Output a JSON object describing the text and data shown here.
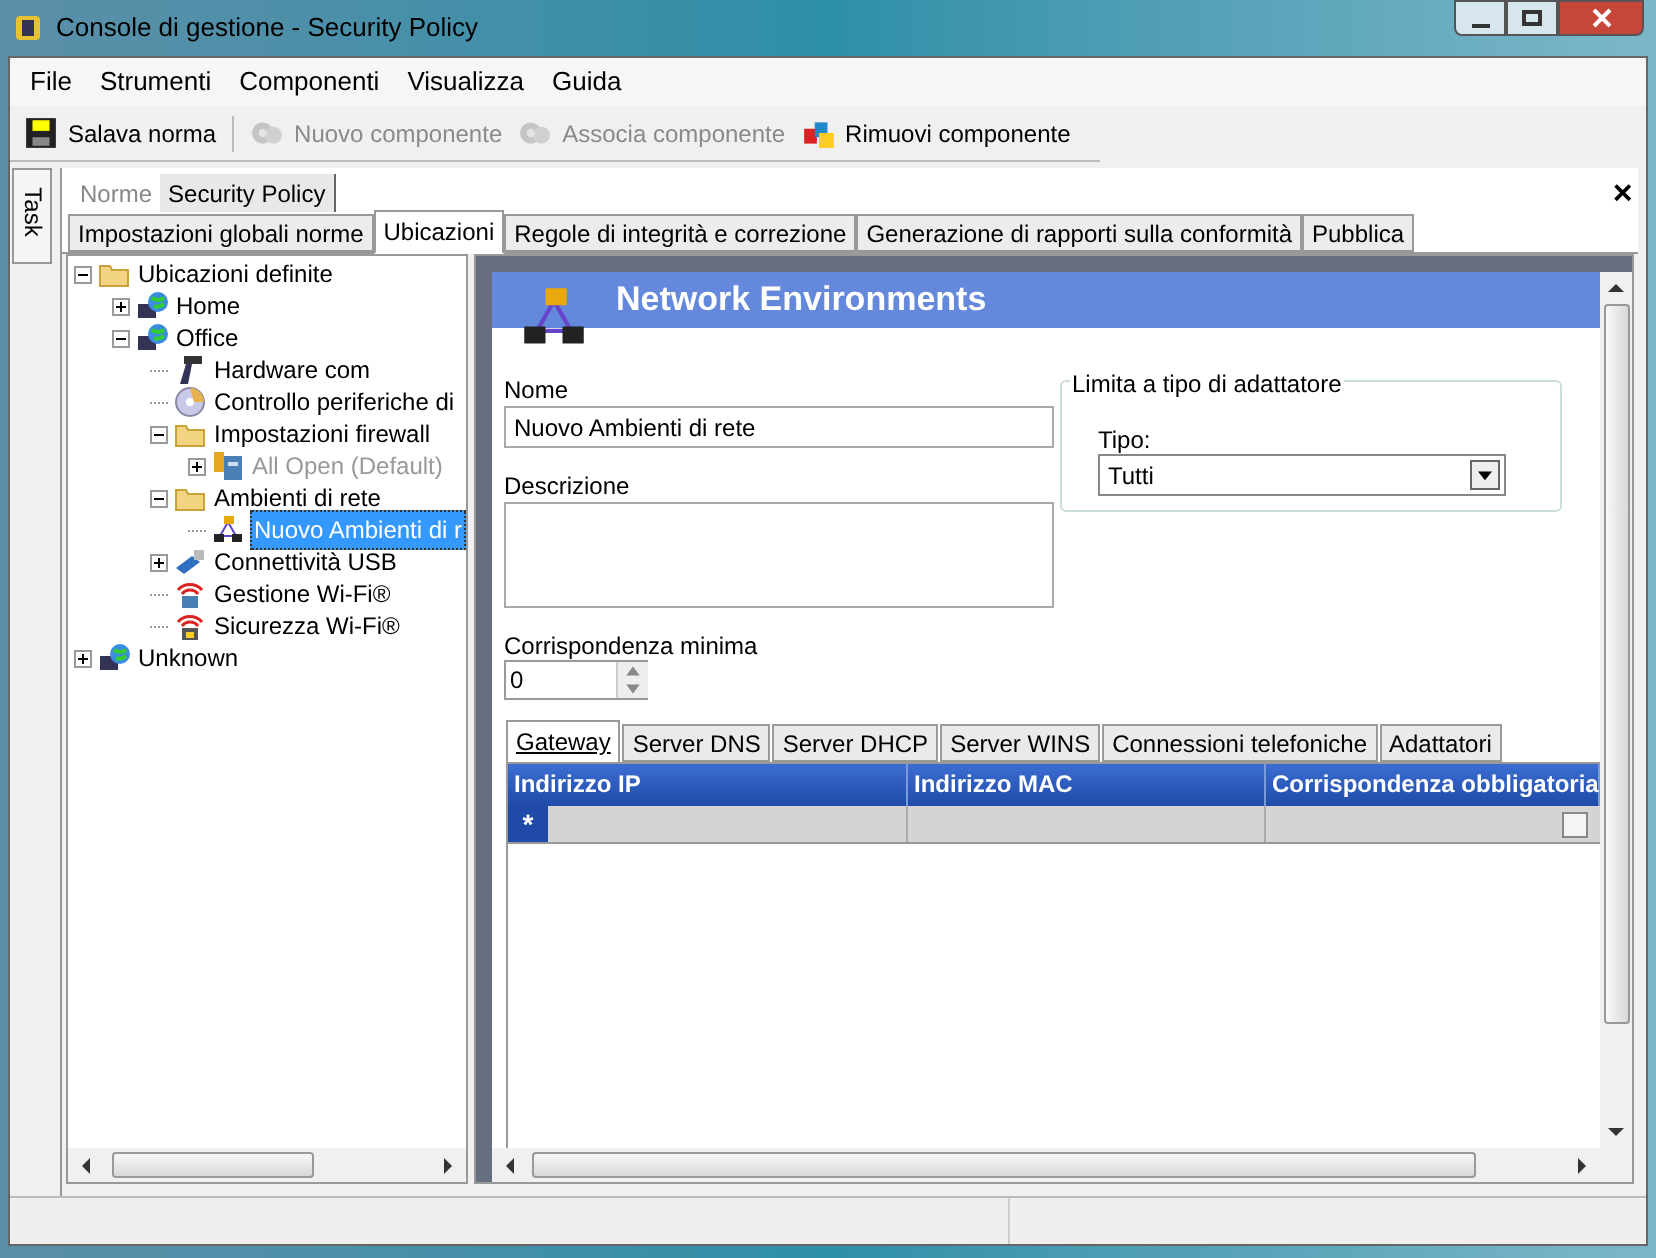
{
  "window": {
    "title": "Console di gestione  - Security Policy"
  },
  "menu": [
    "File",
    "Strumenti",
    "Componenti",
    "Visualizza",
    "Guida"
  ],
  "toolbar": [
    {
      "label": "Salava norma",
      "kind": "floppy",
      "disabled": false
    },
    {
      "label": "Nuovo componente",
      "kind": "gears",
      "disabled": true
    },
    {
      "label": "Associa componente",
      "kind": "gears",
      "disabled": true
    },
    {
      "label": "Rimuovi componente",
      "kind": "cubes",
      "disabled": false
    }
  ],
  "side_tab": "Task",
  "doc_tabs": [
    {
      "label": "Norme",
      "selected": false
    },
    {
      "label": "Security Policy",
      "selected": true
    }
  ],
  "close": "×",
  "tabs": [
    {
      "label": "Impostazioni globali norme",
      "selected": false
    },
    {
      "label": "Ubicazioni",
      "selected": true
    },
    {
      "label": "Regole di integrità e correzione",
      "selected": false
    },
    {
      "label": "Generazione di rapporti sulla conformità",
      "selected": false
    },
    {
      "label": "Pubblica",
      "selected": false
    }
  ],
  "tree": [
    {
      "label": "Ubicazioni definite",
      "kind": "folder",
      "expanded": true,
      "selected": false,
      "disabled": false,
      "children": [
        {
          "label": "Home",
          "kind": "network",
          "expanded": false,
          "selected": false,
          "disabled": false
        },
        {
          "label": "Office",
          "kind": "network",
          "expanded": true,
          "selected": false,
          "disabled": false,
          "children": [
            {
              "label": "Hardware com",
              "kind": "device",
              "selected": false,
              "disabled": false
            },
            {
              "label": "Controllo periferiche di",
              "kind": "disc",
              "selected": false,
              "disabled": false
            },
            {
              "label": "Impostazioni firewall",
              "kind": "folder",
              "expanded": true,
              "selected": false,
              "disabled": false,
              "children": [
                {
                  "label": "All Open (Default)",
                  "kind": "firewall",
                  "expanded": false,
                  "selected": false,
                  "disabled": true
                }
              ]
            },
            {
              "label": "Ambienti di rete",
              "kind": "folder",
              "expanded": true,
              "selected": false,
              "disabled": false,
              "children": [
                {
                  "label": "Nuovo Ambienti di r",
                  "kind": "netenv",
                  "selected": true,
                  "disabled": false
                }
              ]
            },
            {
              "label": "Connettività USB",
              "kind": "usb",
              "expanded": false,
              "selected": false,
              "disabled": false
            },
            {
              "label": "Gestione Wi-Fi®",
              "kind": "wifi",
              "selected": false,
              "disabled": false
            },
            {
              "label": "Sicurezza Wi-Fi®",
              "kind": "wifilock",
              "selected": false,
              "disabled": false
            }
          ]
        }
      ]
    },
    {
      "label": "Unknown",
      "kind": "network",
      "expanded": false,
      "selected": false,
      "disabled": false
    }
  ],
  "panel": {
    "title": "Network Environments",
    "name_label": "Nome",
    "name_value": "Nuovo Ambienti di rete",
    "description_label": "Descrizione",
    "group_title": "Limita a tipo di adattatore",
    "type_label": "Tipo:",
    "type_value": "Tutti",
    "min_label": "Corrispondenza minima",
    "min_value": "0",
    "sub_tabs": [
      {
        "label": "Gateway",
        "selected": true
      },
      {
        "label": "Server DNS",
        "selected": false
      },
      {
        "label": "Server DHCP",
        "selected": false
      },
      {
        "label": "Server WINS",
        "selected": false
      },
      {
        "label": "Connessioni telefoniche",
        "selected": false
      },
      {
        "label": "Adattatori",
        "selected": false
      }
    ],
    "columns": [
      "Indirizzo IP",
      "Indirizzo MAC",
      "Corrispondenza obbligatoria"
    ],
    "new_row": {
      "marker": "*",
      "checked": false
    }
  }
}
